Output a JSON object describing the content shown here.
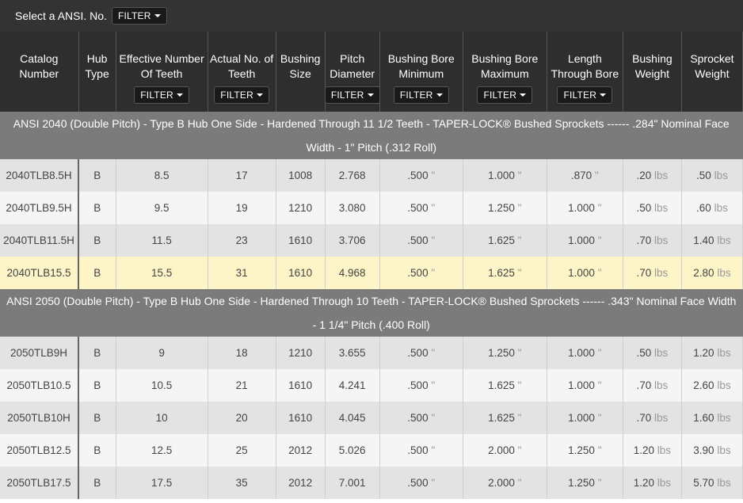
{
  "topbar": {
    "label": "Select a ANSI. No.",
    "filter_label": "FILTER"
  },
  "columns": [
    {
      "label": "Catalog Number",
      "filter": false
    },
    {
      "label": "Hub Type",
      "filter": false
    },
    {
      "label": "Effective Number Of Teeth",
      "filter": true
    },
    {
      "label": "Actual No. of Teeth",
      "filter": true
    },
    {
      "label": "Bushing Size",
      "filter": false
    },
    {
      "label": "Pitch Diameter",
      "filter": true
    },
    {
      "label": "Bushing Bore Minimum",
      "filter": true
    },
    {
      "label": "Bushing Bore Maximum",
      "filter": true
    },
    {
      "label": "Length Through Bore",
      "filter": true
    },
    {
      "label": "Bushing Weight",
      "filter": false
    },
    {
      "label": "Sprocket Weight",
      "filter": false
    }
  ],
  "filter_label": "FILTER",
  "units": {
    "inch": "\"",
    "lbs": "lbs"
  },
  "groups": [
    {
      "title": "ANSI 2040 (Double Pitch) - Type B Hub One Side - Hardened Through 11 1/2 Teeth - TAPER-LOCK® Bushed Sprockets ------ .284\" Nominal Face Width - 1\" Pitch (.312 Roll)",
      "rows": [
        [
          "2040TLB8.5H",
          "B",
          "8.5",
          "17",
          "1008",
          "2.768",
          ".500",
          "1.000",
          ".870",
          ".20",
          ".50"
        ],
        [
          "2040TLB9.5H",
          "B",
          "9.5",
          "19",
          "1210",
          "3.080",
          ".500",
          "1.250",
          "1.000",
          ".50",
          ".60"
        ],
        [
          "2040TLB11.5H",
          "B",
          "11.5",
          "23",
          "1610",
          "3.706",
          ".500",
          "1.625",
          "1.000",
          ".70",
          "1.40"
        ],
        [
          "2040TLB15.5",
          "B",
          "15.5",
          "31",
          "1610",
          "4.968",
          ".500",
          "1.625",
          "1.000",
          ".70",
          "2.80"
        ]
      ],
      "highlight_row": 3
    },
    {
      "title": "ANSI 2050 (Double Pitch) - Type B Hub One Side - Hardened Through 10 Teeth - TAPER-LOCK® Bushed Sprockets ------ .343\" Nominal Face Width - 1 1/4\" Pitch (.400 Roll)",
      "rows": [
        [
          "2050TLB9H",
          "B",
          "9",
          "18",
          "1210",
          "3.655",
          ".500",
          "1.250",
          "1.000",
          ".50",
          "1.20"
        ],
        [
          "2050TLB10.5",
          "B",
          "10.5",
          "21",
          "1610",
          "4.241",
          ".500",
          "1.625",
          "1.000",
          ".70",
          "2.60"
        ],
        [
          "2050TLB10H",
          "B",
          "10",
          "20",
          "1610",
          "4.045",
          ".500",
          "1.625",
          "1.000",
          ".70",
          "1.60"
        ],
        [
          "2050TLB12.5",
          "B",
          "12.5",
          "25",
          "2012",
          "5.026",
          ".500",
          "2.000",
          "1.250",
          "1.20",
          "3.90"
        ],
        [
          "2050TLB17.5",
          "B",
          "17.5",
          "35",
          "2012",
          "7.001",
          ".500",
          "2.000",
          "1.250",
          "1.20",
          "5.70"
        ]
      ],
      "highlight_row": -1
    }
  ],
  "colors": {
    "header_bg": "#2e2e2e",
    "group_bg": "#7b7b7b",
    "row_odd": "#e3e3e3",
    "row_even": "#f5f5f5",
    "row_highlight": "#fdf4c8"
  }
}
